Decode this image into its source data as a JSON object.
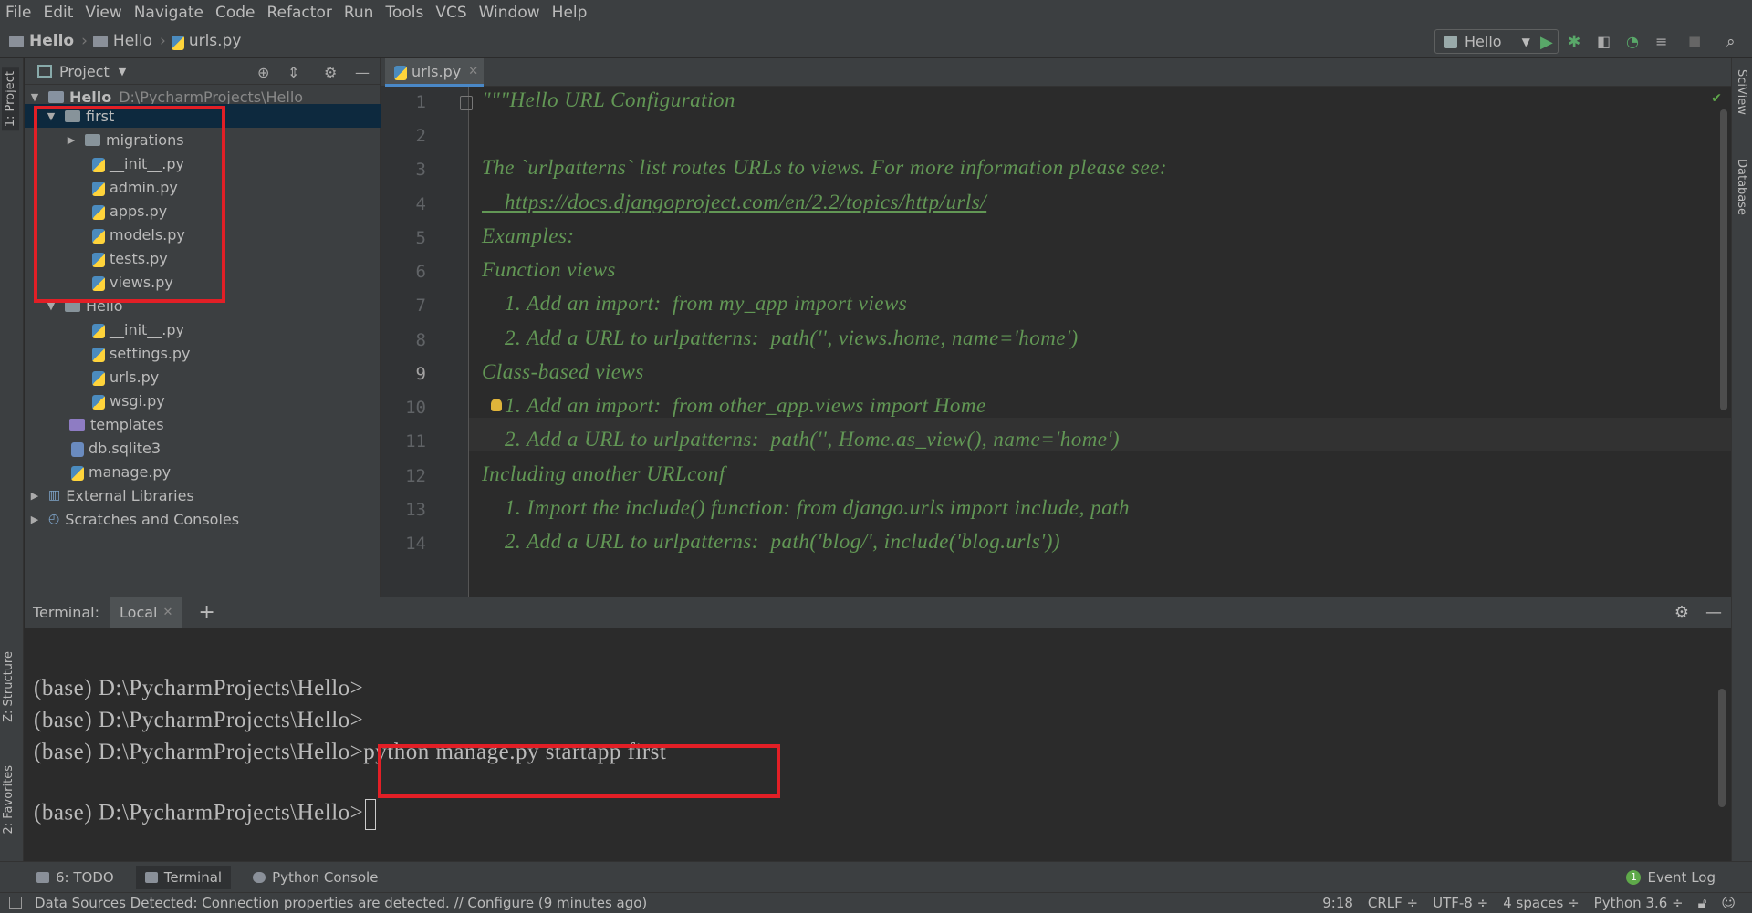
{
  "menu": [
    "File",
    "Edit",
    "View",
    "Navigate",
    "Code",
    "Refactor",
    "Run",
    "Tools",
    "VCS",
    "Window",
    "Help"
  ],
  "breadcrumb": {
    "project": "Hello",
    "folder": "Hello",
    "file": "urls.py"
  },
  "run_config": "Hello",
  "left_tabs": {
    "project": "1: Project",
    "structure": "Z: Structure",
    "favorites": "2: Favorites"
  },
  "right_tabs": {
    "sciview": "SciView",
    "database": "Database"
  },
  "project_panel": {
    "title": "Project",
    "root_name": "Hello",
    "root_path": "D:\\PycharmProjects\\Hello",
    "items": [
      {
        "label": "first"
      },
      {
        "label": "migrations"
      },
      {
        "label": "__init__.py"
      },
      {
        "label": "admin.py"
      },
      {
        "label": "apps.py"
      },
      {
        "label": "models.py"
      },
      {
        "label": "tests.py"
      },
      {
        "label": "views.py"
      },
      {
        "label": "Hello"
      },
      {
        "label": "__init__.py"
      },
      {
        "label": "settings.py"
      },
      {
        "label": "urls.py"
      },
      {
        "label": "wsgi.py"
      },
      {
        "label": "templates"
      },
      {
        "label": "db.sqlite3"
      },
      {
        "label": "manage.py"
      },
      {
        "label": "External Libraries"
      },
      {
        "label": "Scratches and Consoles"
      }
    ]
  },
  "editor": {
    "tab": "urls.py",
    "current_line": 9,
    "lines": [
      "\"\"\"Hello URL Configuration",
      "",
      "The `urlpatterns` list routes URLs to views. For more information please see:",
      "    https://docs.djangoproject.com/en/2.2/topics/http/urls/",
      "Examples:",
      "Function views",
      "    1. Add an import:  from my_app import views",
      "    2. Add a URL to urlpatterns:  path('', views.home, name='home')",
      "Class-based views",
      "    1. Add an import:  from other_app.views import Home",
      "    2. Add a URL to urlpatterns:  path('', Home.as_view(), name='home')",
      "Including another URLconf",
      "    1. Import the include() function: from django.urls import include, path",
      "    2. Add a URL to urlpatterns:  path('blog/', include('blog.urls'))"
    ],
    "line_numbers": [
      "1",
      "2",
      "3",
      "4",
      "5",
      "6",
      "7",
      "8",
      "9",
      "10",
      "11",
      "12",
      "13",
      "14"
    ]
  },
  "terminal": {
    "label": "Terminal:",
    "tab": "Local",
    "plus": "+",
    "lines": [
      "(base) D:\\PycharmProjects\\Hello>",
      "(base) D:\\PycharmProjects\\Hello>",
      "(base) D:\\PycharmProjects\\Hello>python manage.py startapp first",
      "",
      "(base) D:\\PycharmProjects\\Hello>"
    ]
  },
  "toolwindows": {
    "todo": "6: TODO",
    "terminal": "Terminal",
    "python_console": "Python Console",
    "event_log": "Event Log",
    "event_count": "1"
  },
  "status": {
    "message": "Data Sources Detected: Connection properties are detected. // Configure (9 minutes ago)",
    "position": "9:18",
    "line_sep": "CRLF ÷",
    "encoding": "UTF-8 ÷",
    "indent": "4 spaces ÷",
    "interpreter": "Python 3.6 ÷"
  },
  "colors": {
    "highlight": "#e21f26",
    "docstring": "#629755",
    "selection": "#0d293e"
  }
}
